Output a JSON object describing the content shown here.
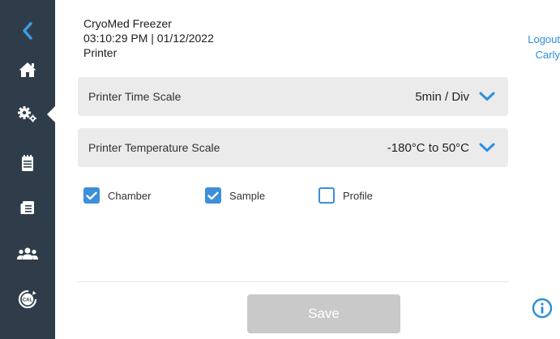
{
  "header": {
    "device_name": "CryoMed Freezer",
    "datetime": "03:10:29 PM | 01/12/2022",
    "page_title": "Printer"
  },
  "user": {
    "logout_label": "Logout",
    "username": "Carly"
  },
  "sidebar": {
    "items": [
      {
        "icon": "chevron-left-icon"
      },
      {
        "icon": "home-icon"
      },
      {
        "icon": "gears-icon",
        "active": true
      },
      {
        "icon": "notepad-icon"
      },
      {
        "icon": "calendar-list-icon"
      },
      {
        "icon": "users-icon"
      },
      {
        "icon": "calibration-icon",
        "text": "CAL"
      }
    ]
  },
  "settings": {
    "time_scale": {
      "label": "Printer Time Scale",
      "value": "5min / Div"
    },
    "temperature_scale": {
      "label": "Printer Temperature Scale",
      "value": "-180°C to 50°C"
    }
  },
  "checkboxes": [
    {
      "label": "Chamber",
      "checked": true
    },
    {
      "label": "Sample",
      "checked": true
    },
    {
      "label": "Profile",
      "checked": false
    }
  ],
  "save_label": "Save",
  "colors": {
    "sidebar": "#2f3d4b",
    "accent": "#3d8fd9",
    "link": "#2b8fd6",
    "disabled_button": "#c9c9c9"
  }
}
